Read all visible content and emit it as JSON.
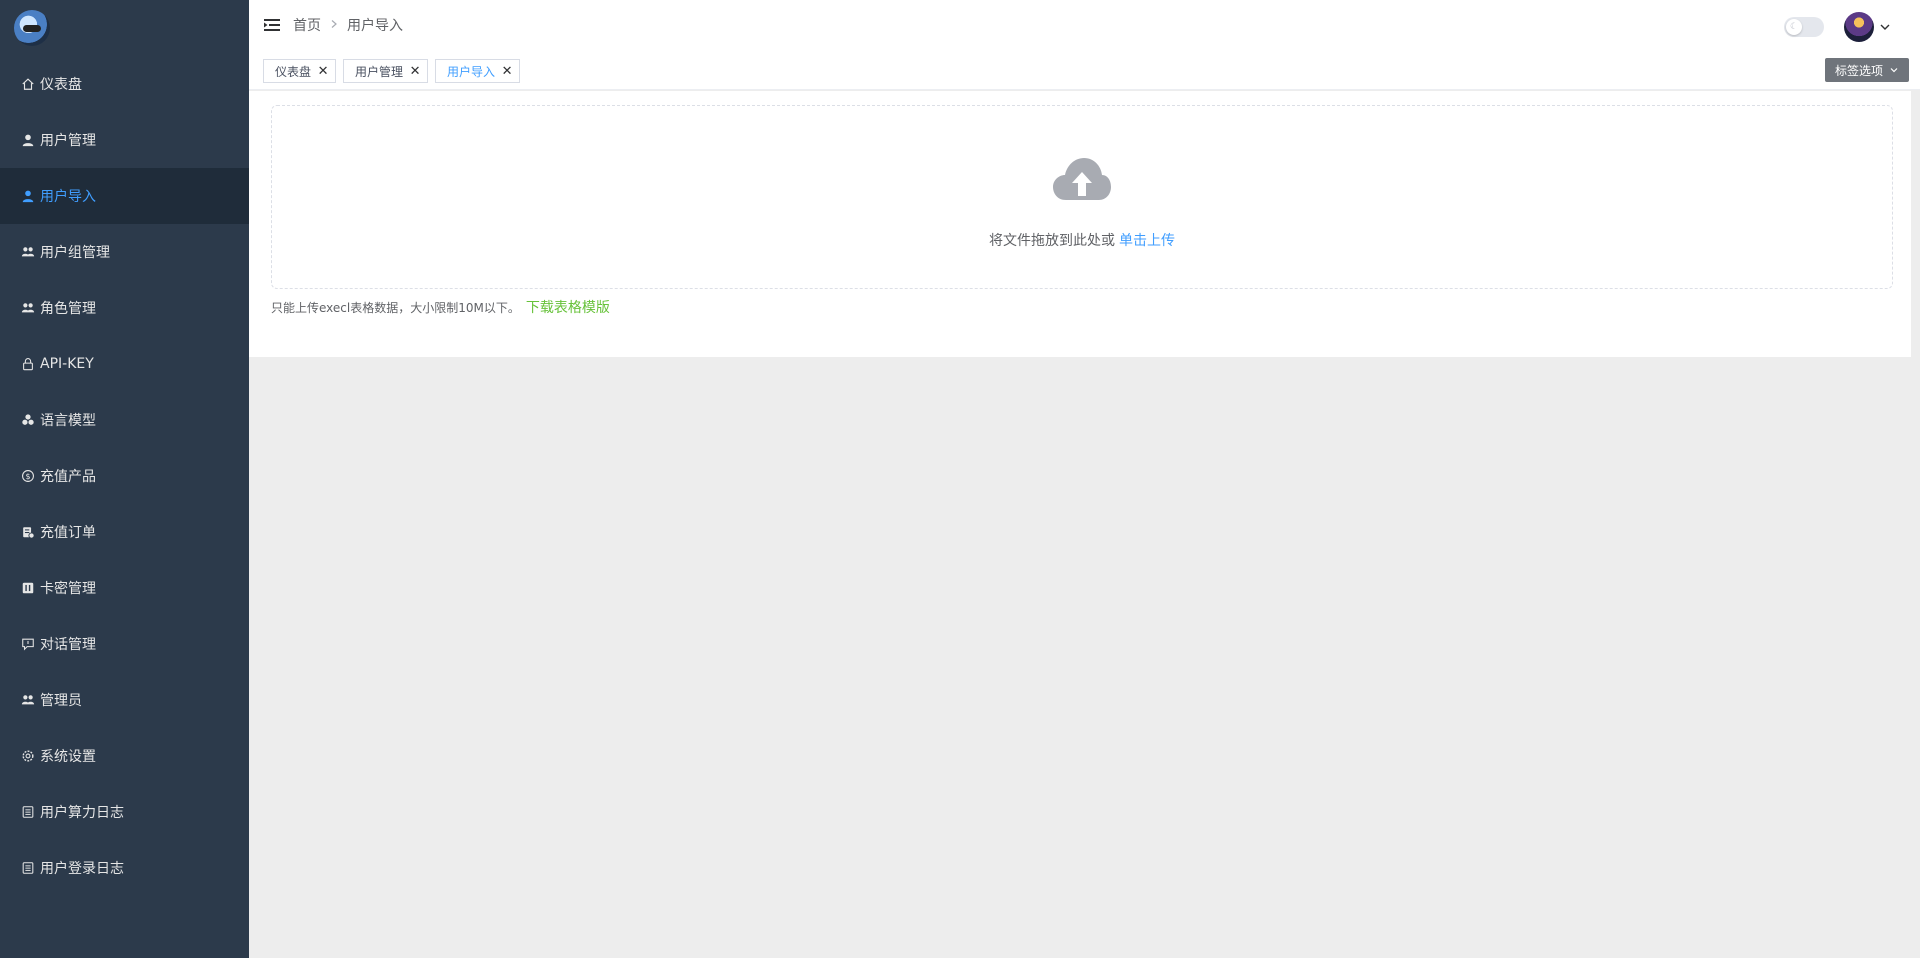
{
  "sidebar": {
    "items": [
      {
        "label": "仪表盘",
        "icon": "home-icon"
      },
      {
        "label": "用户管理",
        "icon": "user-icon"
      },
      {
        "label": "用户导入",
        "icon": "user-icon"
      },
      {
        "label": "用户组管理",
        "icon": "users-icon"
      },
      {
        "label": "角色管理",
        "icon": "users-icon"
      },
      {
        "label": "API-KEY",
        "icon": "lock-icon"
      },
      {
        "label": "语言模型",
        "icon": "cubes-icon"
      },
      {
        "label": "充值产品",
        "icon": "coin-icon"
      },
      {
        "label": "充值订单",
        "icon": "order-icon"
      },
      {
        "label": "卡密管理",
        "icon": "card-icon"
      },
      {
        "label": "对话管理",
        "icon": "chat-icon"
      },
      {
        "label": "管理员",
        "icon": "users-icon"
      },
      {
        "label": "系统设置",
        "icon": "gear-icon"
      },
      {
        "label": "用户算力日志",
        "icon": "list-icon"
      },
      {
        "label": "用户登录日志",
        "icon": "list-icon"
      }
    ],
    "active_index": 2
  },
  "header": {
    "breadcrumb": [
      "首页",
      "用户导入"
    ],
    "theme_switch_on": false
  },
  "tags": {
    "items": [
      {
        "label": "仪表盘",
        "active": false
      },
      {
        "label": "用户管理",
        "active": false
      },
      {
        "label": "用户导入",
        "active": true
      }
    ],
    "options_label": "标签选项"
  },
  "upload": {
    "drop_text": "将文件拖放到此处或",
    "click_text": "单击上传",
    "tip_text": "只能上传execl表格数据，大小限制10M以下。",
    "download_text": "下载表格模版"
  },
  "colors": {
    "sidebar_bg": "#2c3a4b",
    "active": "#409eff",
    "link_green": "#67c23a"
  }
}
